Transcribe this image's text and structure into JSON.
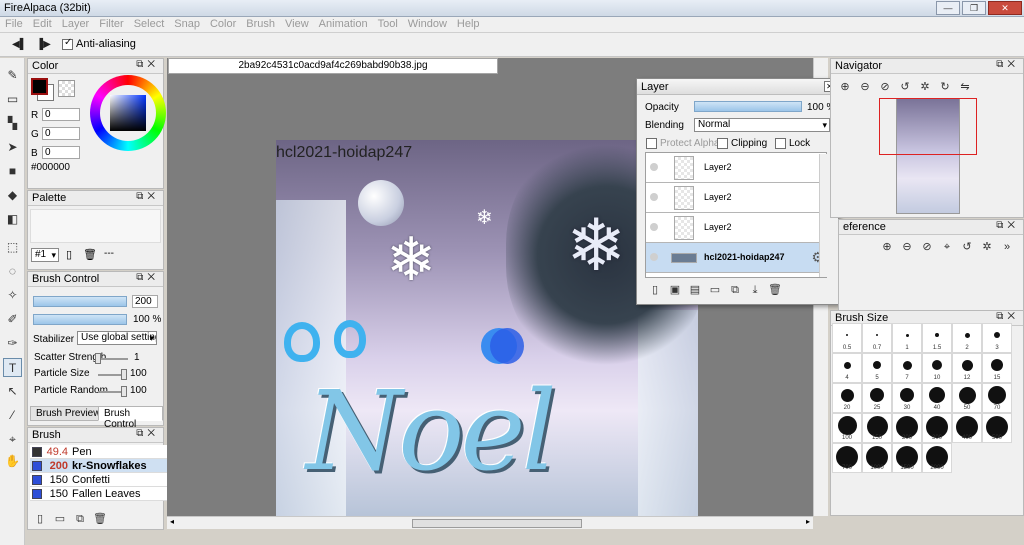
{
  "app": {
    "title": "FireAlpaca (32bit)"
  },
  "menu": [
    "File",
    "Edit",
    "Layer",
    "Filter",
    "Select",
    "Snap",
    "Color",
    "Brush",
    "View",
    "Animation",
    "Tool",
    "Window",
    "Help"
  ],
  "options": {
    "antialias_label": "Anti-aliasing",
    "antialias_checked": true
  },
  "color_panel": {
    "title": "Color",
    "r_label": "R",
    "r_value": "0",
    "g_label": "G",
    "g_value": "0",
    "b_label": "B",
    "b_value": "0",
    "hex": "#000000",
    "fg_color": "#000000",
    "bg_color": "#ffffff"
  },
  "palette_panel": {
    "title": "Palette",
    "selector": "#1",
    "extra": "---"
  },
  "brush_control": {
    "title": "Brush Control",
    "size_value": "200",
    "opacity_value": "100 %",
    "stabilizer_label": "Stabilizer",
    "stabilizer_value": "Use global setting",
    "scatter_label": "Scatter Strength",
    "scatter_value": "1",
    "particle_size_label": "Particle Size",
    "particle_size_value": "100",
    "particle_random_label": "Particle Random",
    "particle_random_value": "100",
    "tab_preview": "Brush Preview",
    "tab_control": "Brush Control"
  },
  "brush_panel": {
    "title": "Brush",
    "items": [
      {
        "size": "49.4",
        "name": "Pen",
        "color": "#333333"
      },
      {
        "size": "200",
        "name": "kr-Snowflakes",
        "color": "#2e4fd8"
      },
      {
        "size": "150",
        "name": "Confetti",
        "color": "#2e4fd8"
      },
      {
        "size": "150",
        "name": "Fallen Leaves",
        "color": "#2e4fd8"
      }
    ]
  },
  "document": {
    "tab_title": "2ba92c4531c0acd9af4c269babd90b38.jpg",
    "canvas_text": "hcl2021-hoidap247"
  },
  "layer_panel": {
    "title": "Layer",
    "opacity_label": "Opacity",
    "opacity_value": "100 %",
    "blending_label": "Blending",
    "blending_value": "Normal",
    "protect_alpha": "Protect Alpha",
    "clipping": "Clipping",
    "lock": "Lock",
    "layers": [
      {
        "name": "Layer2",
        "selected": false
      },
      {
        "name": "Layer2",
        "selected": false
      },
      {
        "name": "Layer2",
        "selected": false
      },
      {
        "name": "hcl2021-hoidap247",
        "selected": true
      }
    ]
  },
  "navigator_panel": {
    "title": "Navigator"
  },
  "reference_panel": {
    "title": "eference"
  },
  "brush_size_panel": {
    "title": "Brush Size",
    "sizes": [
      "0.5",
      "0.7",
      "1",
      "1.5",
      "2",
      "3",
      "4",
      "5",
      "7",
      "10",
      "12",
      "15",
      "20",
      "25",
      "30",
      "40",
      "50",
      "70",
      "100",
      "150",
      "200",
      "300",
      "400",
      "500",
      "700",
      "1000",
      "1500",
      "2000"
    ]
  },
  "accent": "#3b78c4"
}
